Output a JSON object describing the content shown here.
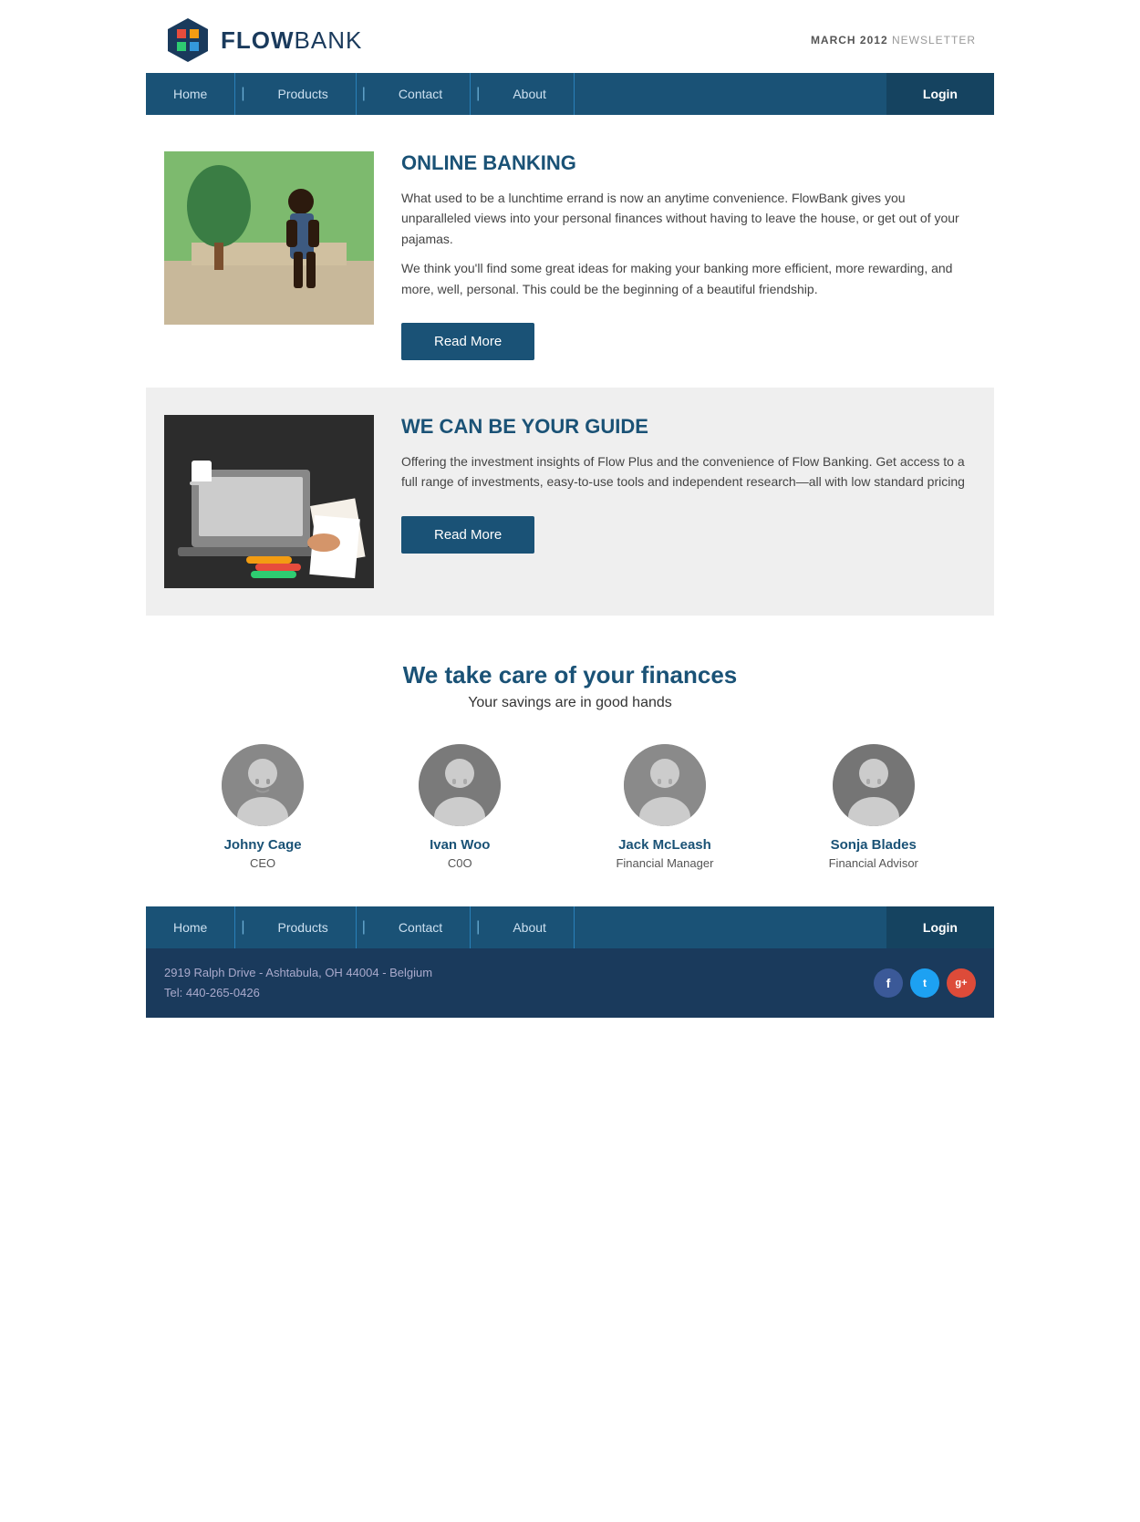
{
  "header": {
    "logo_flow": "FLOW",
    "logo_bank": "BANK",
    "newsletter_label": "MARCH 2012",
    "newsletter_suffix": "NEWSLETTER"
  },
  "nav": {
    "items": [
      {
        "label": "Home",
        "id": "home"
      },
      {
        "label": "Products",
        "id": "products"
      },
      {
        "label": "Contact",
        "id": "contact"
      },
      {
        "label": "About",
        "id": "about"
      }
    ],
    "login_label": "Login"
  },
  "articles": [
    {
      "title": "ONLINE BANKING",
      "body1": "What used to be a lunchtime errand is now an anytime convenience. FlowBank gives you unparalleled views into your personal finances without having to leave the house, or get out of your pajamas.",
      "body2": "We think you'll find some great ideas for making your banking more efficient, more rewarding, and more, well, personal. This could be the beginning of a beautiful friendship.",
      "button": "Read More",
      "gray": false
    },
    {
      "title": "WE CAN BE YOUR GUIDE",
      "body1": "Offering the investment insights of Flow Plus and the convenience of Flow Banking. Get access to a full range of investments, easy-to-use tools and independent research—all with low standard pricing",
      "body2": "",
      "button": "Read More",
      "gray": true
    }
  ],
  "team_section": {
    "title": "We take care of your finances",
    "subtitle": "Your savings are in good hands",
    "members": [
      {
        "name": "Johny Cage",
        "role": "CEO"
      },
      {
        "name": "Ivan Woo",
        "role": "C0O"
      },
      {
        "name": "Jack McLeash",
        "role": "Financial Manager"
      },
      {
        "name": "Sonja Blades",
        "role": "Financial Advisor"
      }
    ]
  },
  "footer": {
    "nav": {
      "items": [
        {
          "label": "Home"
        },
        {
          "label": "Products"
        },
        {
          "label": "Contact"
        },
        {
          "label": "About"
        }
      ],
      "login_label": "Login"
    },
    "address": "2919 Ralph Drive - Ashtabula, OH 44004 - Belgium",
    "tel": "Tel: 440-265-0426",
    "social": [
      {
        "label": "f",
        "type": "facebook"
      },
      {
        "label": "t",
        "type": "twitter"
      },
      {
        "label": "g+",
        "type": "googleplus"
      }
    ]
  }
}
